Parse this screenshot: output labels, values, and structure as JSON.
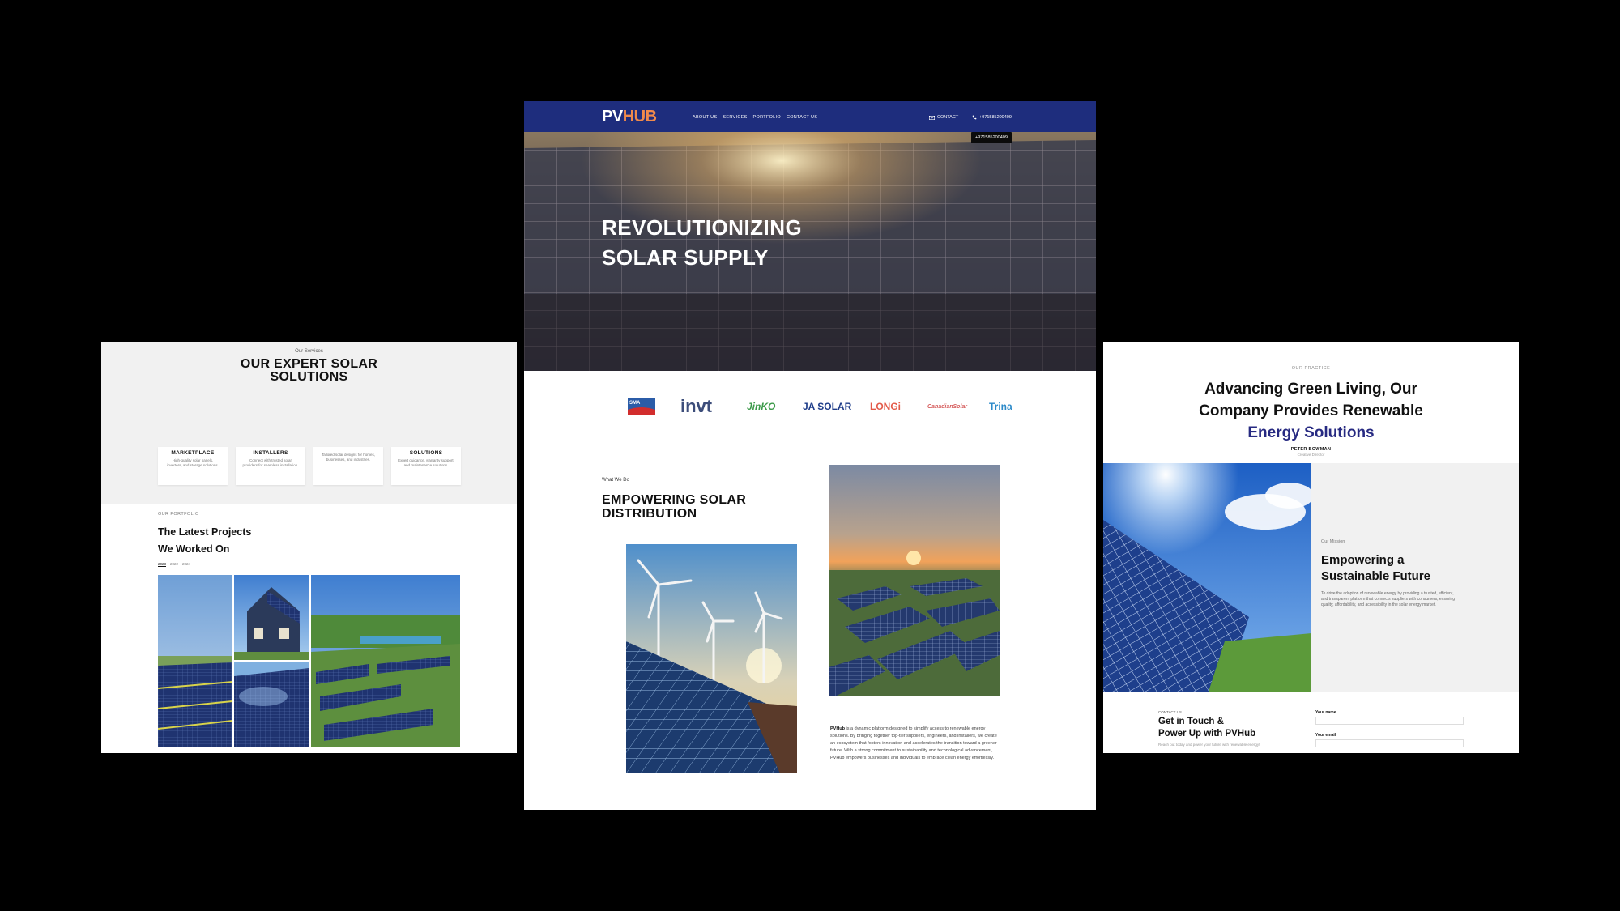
{
  "left_panel": {
    "services_eyebrow": "Our Services",
    "services_title_line1": "OUR EXPERT SOLAR",
    "services_title_line2": "SOLUTIONS",
    "cards": [
      {
        "title": "MARKETPLACE",
        "desc": "High-quality solar panels, inverters, and storage solutions."
      },
      {
        "title": "INSTALLERS",
        "desc": "Connect with trusted solar providers for seamless installation."
      },
      {
        "title": "",
        "desc": "Tailored solar designs for homes, businesses, and industries."
      },
      {
        "title": "SOLUTIONS",
        "desc": "Expert guidance, warranty support, and maintenance solutions."
      }
    ],
    "portfolio_eyebrow": "OUR PORTFOLIO",
    "portfolio_title_line1": "The Latest Projects",
    "portfolio_title_line2": "We Worked On",
    "years": [
      "2023",
      "2022",
      "2024"
    ]
  },
  "center_panel": {
    "logo_pv": "PV",
    "logo_hub": "HUB",
    "nav": [
      "ABOUT US",
      "SERVICES",
      "PORTFOLIO",
      "CONTACT US"
    ],
    "contact_label": "CONTACT",
    "phone": "+971585200409",
    "phone_tooltip": "+971585200409",
    "hero_line1": "REVOLUTIONIZING",
    "hero_line2": "SOLAR SUPPLY",
    "brands": [
      "SMA",
      "invt",
      "JinKO",
      "JA SOLAR",
      "LONGi",
      "CanadianSolar",
      "Trina"
    ],
    "what_we_do": "What We Do",
    "section_title_line1": "EMPOWERING SOLAR",
    "section_title_line2": "DISTRIBUTION",
    "paragraph_brand": "PVHub",
    "paragraph": " is a dynamic platform designed to simplify access to renewable energy solutions. By bringing together top-tier suppliers, engineers, and installers, we create an ecosystem that fosters innovation and accelerates the transition toward a greener future. With a strong commitment to sustainability and technological advancement, PVHub empowers businesses and individuals to embrace clean energy effortlessly."
  },
  "right_panel": {
    "eyebrow": "OUR PRACTICE",
    "title_line1": "Advancing Green Living, Our",
    "title_line2": "Company Provides Renewable",
    "title_line3": "Energy Solutions",
    "author": "PETER BOWMAN",
    "role": "Creative Director",
    "mission_eyebrow": "Our Mission",
    "mission_title_line1": "Empowering a",
    "mission_title_line2": "Sustainable Future",
    "mission_text": "To drive the adoption of renewable energy by providing a trusted, efficient, and transparent platform that connects suppliers with consumers, ensuring quality, affordability, and accessibility in the solar energy market.",
    "contact_eyebrow": "CONTACT US",
    "contact_title_line1": "Get in Touch &",
    "contact_title_line2": "Power Up with PVHub",
    "contact_sub": "Reach out today and power your future with renewable energy!",
    "field_name_label": "Your name",
    "field_email_label": "Your email"
  },
  "colors": {
    "nav_blue": "#1e2d7d",
    "logo_orange": "#f08a4b",
    "accent_navy": "#272a82",
    "gray_bg": "#f1f1f1"
  }
}
